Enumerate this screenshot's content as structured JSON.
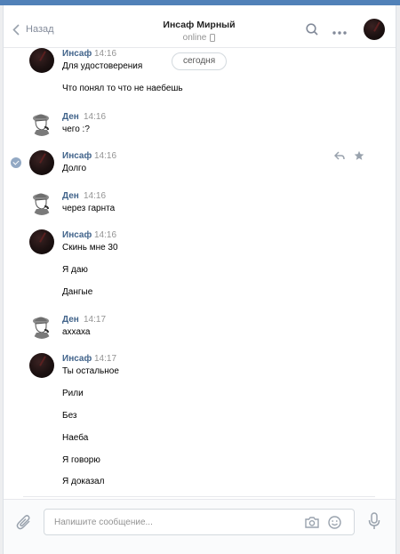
{
  "header": {
    "back_label": "Назад",
    "title": "Инсаф Мирный",
    "status": "online"
  },
  "date_pill": "сегодня",
  "messages": [
    {
      "name": "Инсаф",
      "time": "14:16",
      "lines": [
        "Для удостоверения",
        "Что понял то что не наебешь"
      ]
    },
    {
      "name": "Ден",
      "time": "14:16",
      "lines": [
        "чего :?"
      ]
    },
    {
      "name": "Инсаф",
      "time": "14:16",
      "lines": [
        "Долго"
      ]
    },
    {
      "name": "Ден",
      "time": "14:16",
      "lines": [
        "через гарнта"
      ]
    },
    {
      "name": "Инсаф",
      "time": "14:16",
      "lines": [
        "Скинь мне 30",
        "Я даю",
        "Дангые"
      ]
    },
    {
      "name": "Ден",
      "time": "14:17",
      "lines": [
        "аххаха"
      ]
    },
    {
      "name": "Инсаф",
      "time": "14:17",
      "lines": [
        "Ты остальное",
        "Рили",
        "Без",
        "Наеба",
        "Я говорю",
        "Я доказал"
      ]
    }
  ],
  "composer": {
    "placeholder": "Напишите сообщение..."
  },
  "icons": {
    "back": "chevron-left-icon",
    "search": "search-icon",
    "more": "more-dots-icon",
    "mobile": "mobile-phone-icon",
    "reply": "reply-icon",
    "favorite": "star-icon",
    "selected": "check-circle-icon",
    "attach": "paperclip-icon",
    "camera": "camera-icon",
    "emoji": "smile-icon",
    "voice": "microphone-icon"
  },
  "colors": {
    "accent": "#5181b8",
    "name_link": "#42648b",
    "muted": "#939393"
  }
}
